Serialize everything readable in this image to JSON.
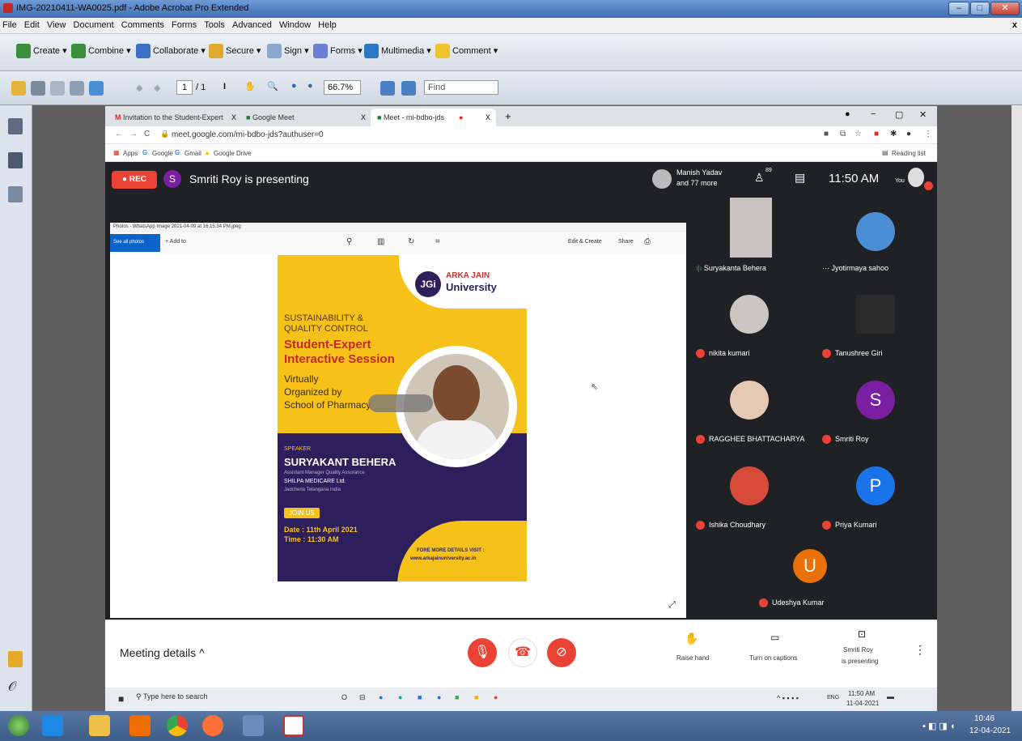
{
  "window": {
    "title": "IMG-20210411-WA0025.pdf - Adobe Acrobat Pro Extended",
    "controls": [
      "–",
      "□",
      "✕"
    ],
    "close_doc": "x"
  },
  "menu": [
    "File",
    "Edit",
    "View",
    "Document",
    "Comments",
    "Forms",
    "Tools",
    "Advanced",
    "Window",
    "Help"
  ],
  "toolbar1": {
    "create": "Create ▾",
    "combine": "Combine ▾",
    "collaborate": "Collaborate ▾",
    "secure": "Secure ▾",
    "sign": "Sign ▾",
    "forms": "Forms ▾",
    "multimedia": "Multimedia ▾",
    "comment": "Comment ▾"
  },
  "toolbar2": {
    "page_current": "1",
    "page_total": "/ 1",
    "zoom": "66.7%",
    "find_placeholder": "Find"
  },
  "browser": {
    "tabs": [
      {
        "label": "Invitation to the Student-Expert",
        "close": "X"
      },
      {
        "label": "Google Meet",
        "close": "X"
      },
      {
        "label": "Meet - mi-bdbo-jds",
        "close": "X"
      }
    ],
    "new_tab": "+",
    "url": "meet.google.com/mi-bdbo-jds?authuser=0",
    "bookmarks": [
      "Apps",
      "Google",
      "Gmail",
      "Google Drive"
    ],
    "reading_list": "Reading list"
  },
  "meet": {
    "rec_label": "REC",
    "presenter_initial": "S",
    "presenting_text": "Smriti Roy is presenting",
    "participants_name": "Manish Yadav",
    "participants_more": "and 77 more",
    "participant_count": "89",
    "time": "11:50 AM",
    "you_label": "You",
    "photo_title": "Photos - WhatsApp Image 2021-04-09 at 16.15.34 PM.jpeg",
    "see_all_photos": "See all photos",
    "add_to": "Add to",
    "edit_create": "Edit & Create",
    "share": "Share",
    "tiles": [
      {
        "name": "Suryakanta Behera"
      },
      {
        "name": "Jyotirmaya sahoo"
      },
      {
        "name": "nikita kumari"
      },
      {
        "name": "Tanushree Giri"
      },
      {
        "name": "RAGGHEE BHATTACHARYA"
      },
      {
        "name": "Smriti Roy",
        "initial": "S"
      },
      {
        "name": "Ishika Choudhary"
      },
      {
        "name": "Priya Kumari",
        "initial": "P"
      },
      {
        "name": "Udeshya Kumar",
        "initial": "U"
      }
    ],
    "meeting_details": "Meeting details",
    "raise_hand": "Raise hand",
    "captions": "Turn on captions",
    "presenting_btn_line1": "Smriti Roy",
    "presenting_btn_line2": "is presenting"
  },
  "poster": {
    "logo_text": "JGi",
    "university_line1": "ARKA JAIN",
    "university_line2": "University",
    "line1": "SUSTAINABILITY &",
    "line2": "QUALITY CONTROL",
    "headline1": "Student-Expert",
    "headline2": "Interactive Session",
    "sub1": "Virtually",
    "sub2": "Organized by",
    "sub3": "School of Pharmacy",
    "speaker_label": "SPEAKER",
    "speaker_name": "SURYAKANT BEHERA",
    "speaker_role": "Assistant Manager Quality Assurance",
    "company": "SHILPA MEDICARE Ltd.",
    "location": "Jadcherla Telangana India",
    "join": "JOIN US",
    "date": "Date : 11th April 2021",
    "time": "Time : 11:30 AM",
    "details1": "FORE MORE DETAILS VISIT :",
    "details2": "www.arkajainuniversity.ac.in"
  },
  "inner_taskbar": {
    "search_placeholder": "Type here to search",
    "lang": "ENG",
    "time": "11:50 AM",
    "date": "11-04-2021"
  },
  "outer_taskbar": {
    "time": "10:46",
    "date": "12-04-2021"
  },
  "colors": {
    "meet_bg": "#202124",
    "red": "#ea4335",
    "poster_yellow": "#f6c21a",
    "poster_purple": "#2c1f5c"
  }
}
